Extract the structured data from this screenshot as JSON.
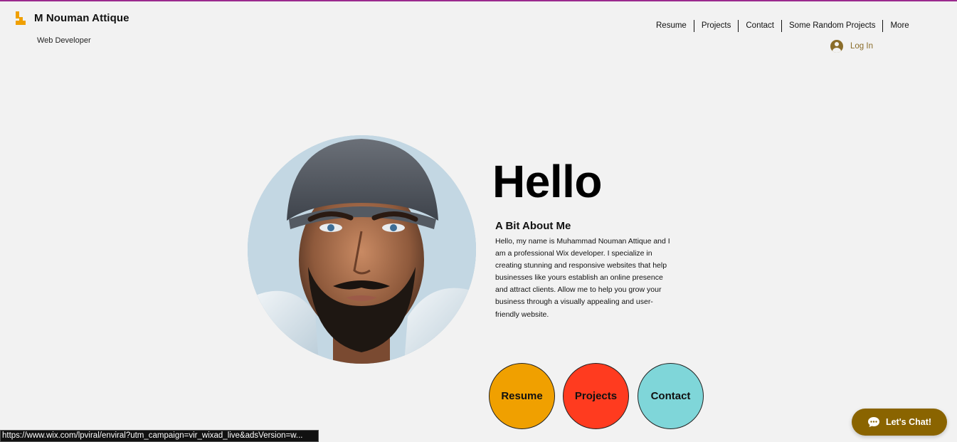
{
  "header": {
    "logo_icon": "stairs-logo-icon",
    "title": "M Nouman Attique",
    "subtitle": "Web Developer",
    "nav": [
      {
        "label": "Resume"
      },
      {
        "label": "Projects"
      },
      {
        "label": "Contact"
      },
      {
        "label": "Some Random Projects"
      },
      {
        "label": "More"
      }
    ],
    "login_label": "Log In"
  },
  "hero": {
    "portrait_alt": "portrait",
    "greeting": "Hello",
    "about_heading": "A Bit About Me",
    "about_body": "Hello, my name is Muhammad Nouman Attique and I am a professional Wix developer. I specialize in creating stunning and responsive websites that help businesses like yours establish an online presence and attract clients. Allow me to help you grow your business through a visually appealing and user-friendly website.",
    "buttons": [
      {
        "label": "Resume",
        "color": "#f0a000"
      },
      {
        "label": "Projects",
        "color": "#ff3b1f"
      },
      {
        "label": "Contact",
        "color": "#7fd6d9"
      }
    ]
  },
  "chat": {
    "label": "Let's Chat!",
    "icon": "chat-bubble-icon",
    "color": "#8a6400"
  },
  "status_url": "https://www.wix.com/lpviral/enviral?utm_campaign=vir_wixad_live&adsVersion=w...",
  "colors": {
    "accent_gold": "#8a6d2a",
    "top_rule": "#9b2a8e",
    "background": "#f2f2f2"
  }
}
